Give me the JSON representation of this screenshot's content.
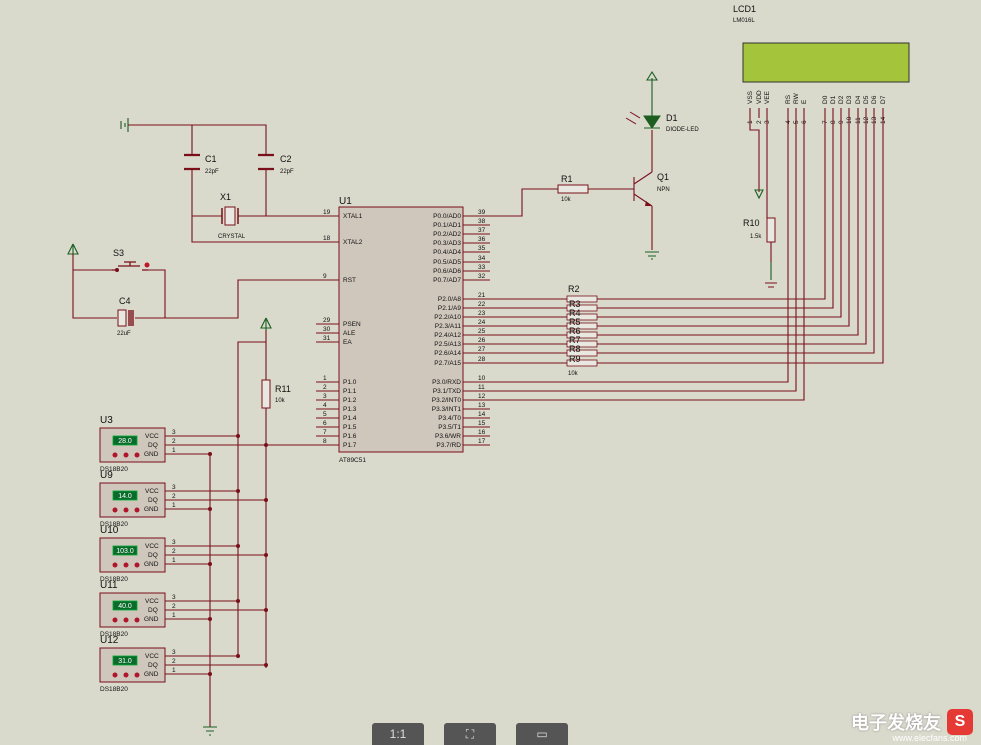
{
  "lcd": {
    "ref": "LCD1",
    "part": "LM016L",
    "pins": [
      "VSS",
      "VDD",
      "VEE",
      "RS",
      "RW",
      "E",
      "D0",
      "D1",
      "D2",
      "D3",
      "D4",
      "D5",
      "D6",
      "D7"
    ],
    "nums": [
      "1",
      "2",
      "3",
      "4",
      "5",
      "6",
      "7",
      "8",
      "9",
      "10",
      "11",
      "12",
      "13",
      "14"
    ],
    "color": "#a4c43b"
  },
  "mcu": {
    "ref": "U1",
    "part": "AT89C51",
    "left": [
      [
        "19",
        "XTAL1"
      ],
      [
        "18",
        "XTAL2"
      ],
      [
        "9",
        "RST"
      ],
      [
        "29",
        "PSEN"
      ],
      [
        "30",
        "ALE"
      ],
      [
        "31",
        "EA"
      ],
      [
        "1",
        "P1.0"
      ],
      [
        "2",
        "P1.1"
      ],
      [
        "3",
        "P1.2"
      ],
      [
        "4",
        "P1.3"
      ],
      [
        "5",
        "P1.4"
      ],
      [
        "6",
        "P1.5"
      ],
      [
        "7",
        "P1.6"
      ],
      [
        "8",
        "P1.7"
      ]
    ],
    "right": [
      [
        "39",
        "P0.0/AD0"
      ],
      [
        "38",
        "P0.1/AD1"
      ],
      [
        "37",
        "P0.2/AD2"
      ],
      [
        "36",
        "P0.3/AD3"
      ],
      [
        "35",
        "P0.4/AD4"
      ],
      [
        "34",
        "P0.5/AD5"
      ],
      [
        "33",
        "P0.6/AD6"
      ],
      [
        "32",
        "P0.7/AD7"
      ],
      [
        "21",
        "P2.0/A8"
      ],
      [
        "22",
        "P2.1/A9"
      ],
      [
        "23",
        "P2.2/A10"
      ],
      [
        "24",
        "P2.3/A11"
      ],
      [
        "25",
        "P2.4/A12"
      ],
      [
        "26",
        "P2.5/A13"
      ],
      [
        "27",
        "P2.6/A14"
      ],
      [
        "28",
        "P2.7/A15"
      ],
      [
        "10",
        "P3.0/RXD"
      ],
      [
        "11",
        "P3.1/TXD"
      ],
      [
        "12",
        "P3.2/INT0"
      ],
      [
        "13",
        "P3.3/INT1"
      ],
      [
        "14",
        "P3.4/T0"
      ],
      [
        "15",
        "P3.5/T1"
      ],
      [
        "16",
        "P3.6/WR"
      ],
      [
        "17",
        "P3.7/RD"
      ]
    ]
  },
  "c1": {
    "ref": "C1",
    "val": "22pF"
  },
  "c2": {
    "ref": "C2",
    "val": "22pF"
  },
  "x1": {
    "ref": "X1",
    "val": "CRYSTAL"
  },
  "s3": {
    "ref": "S3"
  },
  "c4": {
    "ref": "C4",
    "val": "22uF"
  },
  "r1": {
    "ref": "R1",
    "val": "10k"
  },
  "r2": {
    "ref": "R2",
    "val": "10k",
    "labels": [
      "R3",
      "R4",
      "R5",
      "R6",
      "R7",
      "R8",
      "R9"
    ]
  },
  "r10": {
    "ref": "R10",
    "val": "1.5k"
  },
  "r11": {
    "ref": "R11",
    "val": "10k"
  },
  "q1": {
    "ref": "Q1",
    "val": "NPN"
  },
  "d1": {
    "ref": "D1",
    "val": "DIODE-LED"
  },
  "sensors": [
    {
      "ref": "U3",
      "temp": "28.0"
    },
    {
      "ref": "U9",
      "temp": "14.0"
    },
    {
      "ref": "U10",
      "temp": "103.0"
    },
    {
      "ref": "U11",
      "temp": "40.0"
    },
    {
      "ref": "U12",
      "temp": "31.0"
    }
  ],
  "sensor_part": "DS18B20",
  "sensor_pins": {
    "vcc": "VCC",
    "dq": "DQ",
    "gnd": "GND",
    "n3": "3",
    "n2": "2",
    "n1": "1"
  },
  "toolbar": {
    "zoom_label": "1:1"
  },
  "watermark": {
    "brand": "电子发烧友",
    "url": "www.elecfans.com"
  }
}
